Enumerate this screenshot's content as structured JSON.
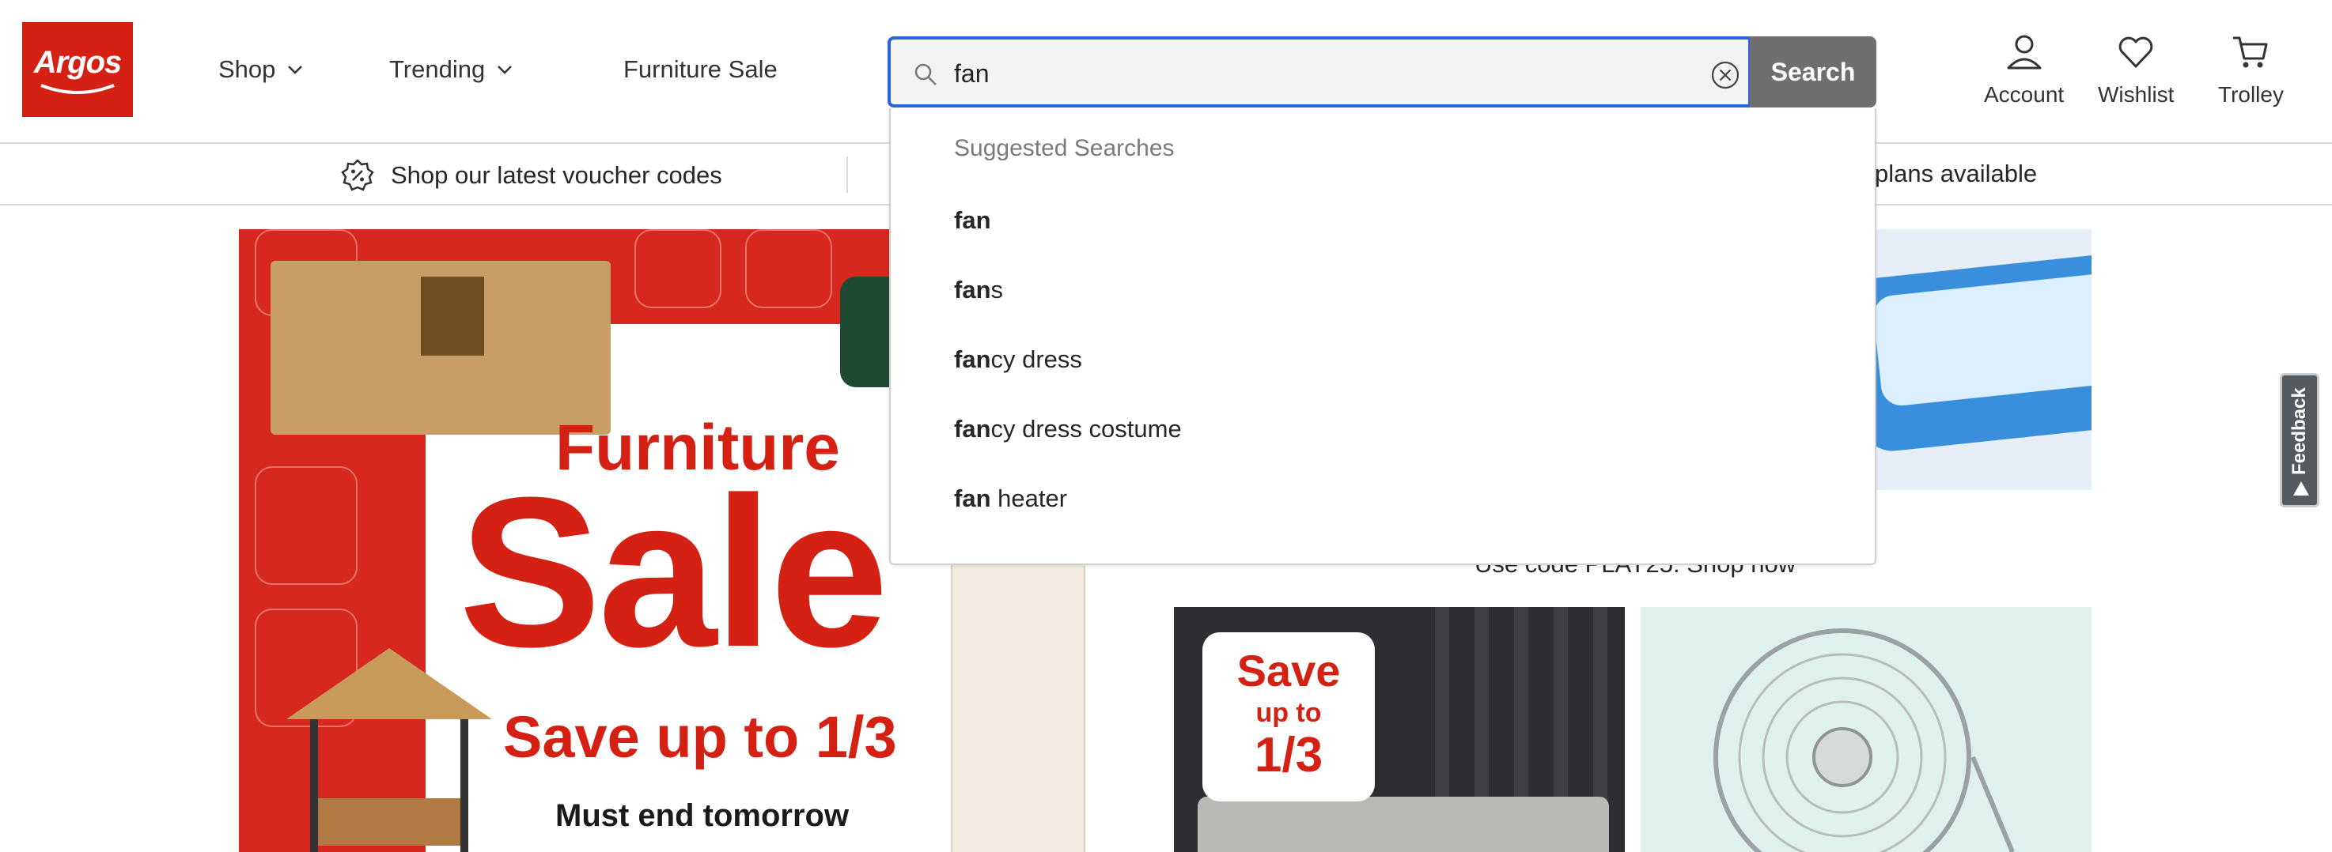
{
  "header": {
    "logo_text": "Argos",
    "nav": [
      {
        "label": "Shop",
        "has_dropdown": true
      },
      {
        "label": "Trending",
        "has_dropdown": true
      },
      {
        "label": "Furniture Sale",
        "has_dropdown": false
      }
    ],
    "search": {
      "value": "fan",
      "button_label": "Search"
    },
    "account_label": "Account",
    "wishlist_label": "Wishlist",
    "trolley_label": "Trolley"
  },
  "strip": {
    "left_text": "Shop our latest voucher codes",
    "right_text": "plans available"
  },
  "suggestions": {
    "heading": "Suggested Searches",
    "items": [
      {
        "match": "fan",
        "rest": ""
      },
      {
        "match": "fan",
        "rest": "s"
      },
      {
        "match": "fan",
        "rest": "cy dress"
      },
      {
        "match": "fan",
        "rest": "cy dress costume"
      },
      {
        "match": "fan",
        "rest": " heater"
      }
    ]
  },
  "banners": {
    "main": {
      "title_line1": "Furniture",
      "title_line2": "Sale",
      "save_text": "Save up to 1/3",
      "must_text": "Must end tomorrow"
    },
    "pool_caption": "Use code PLAY25. Shop now",
    "garden": {
      "save": "Save",
      "up_to": "up to",
      "amount": "1/3"
    }
  },
  "feedback_label": "Feedback",
  "colors": {
    "brand_red": "#d42114",
    "search_focus": "#2b64d9",
    "search_button": "#6f6f6f"
  }
}
